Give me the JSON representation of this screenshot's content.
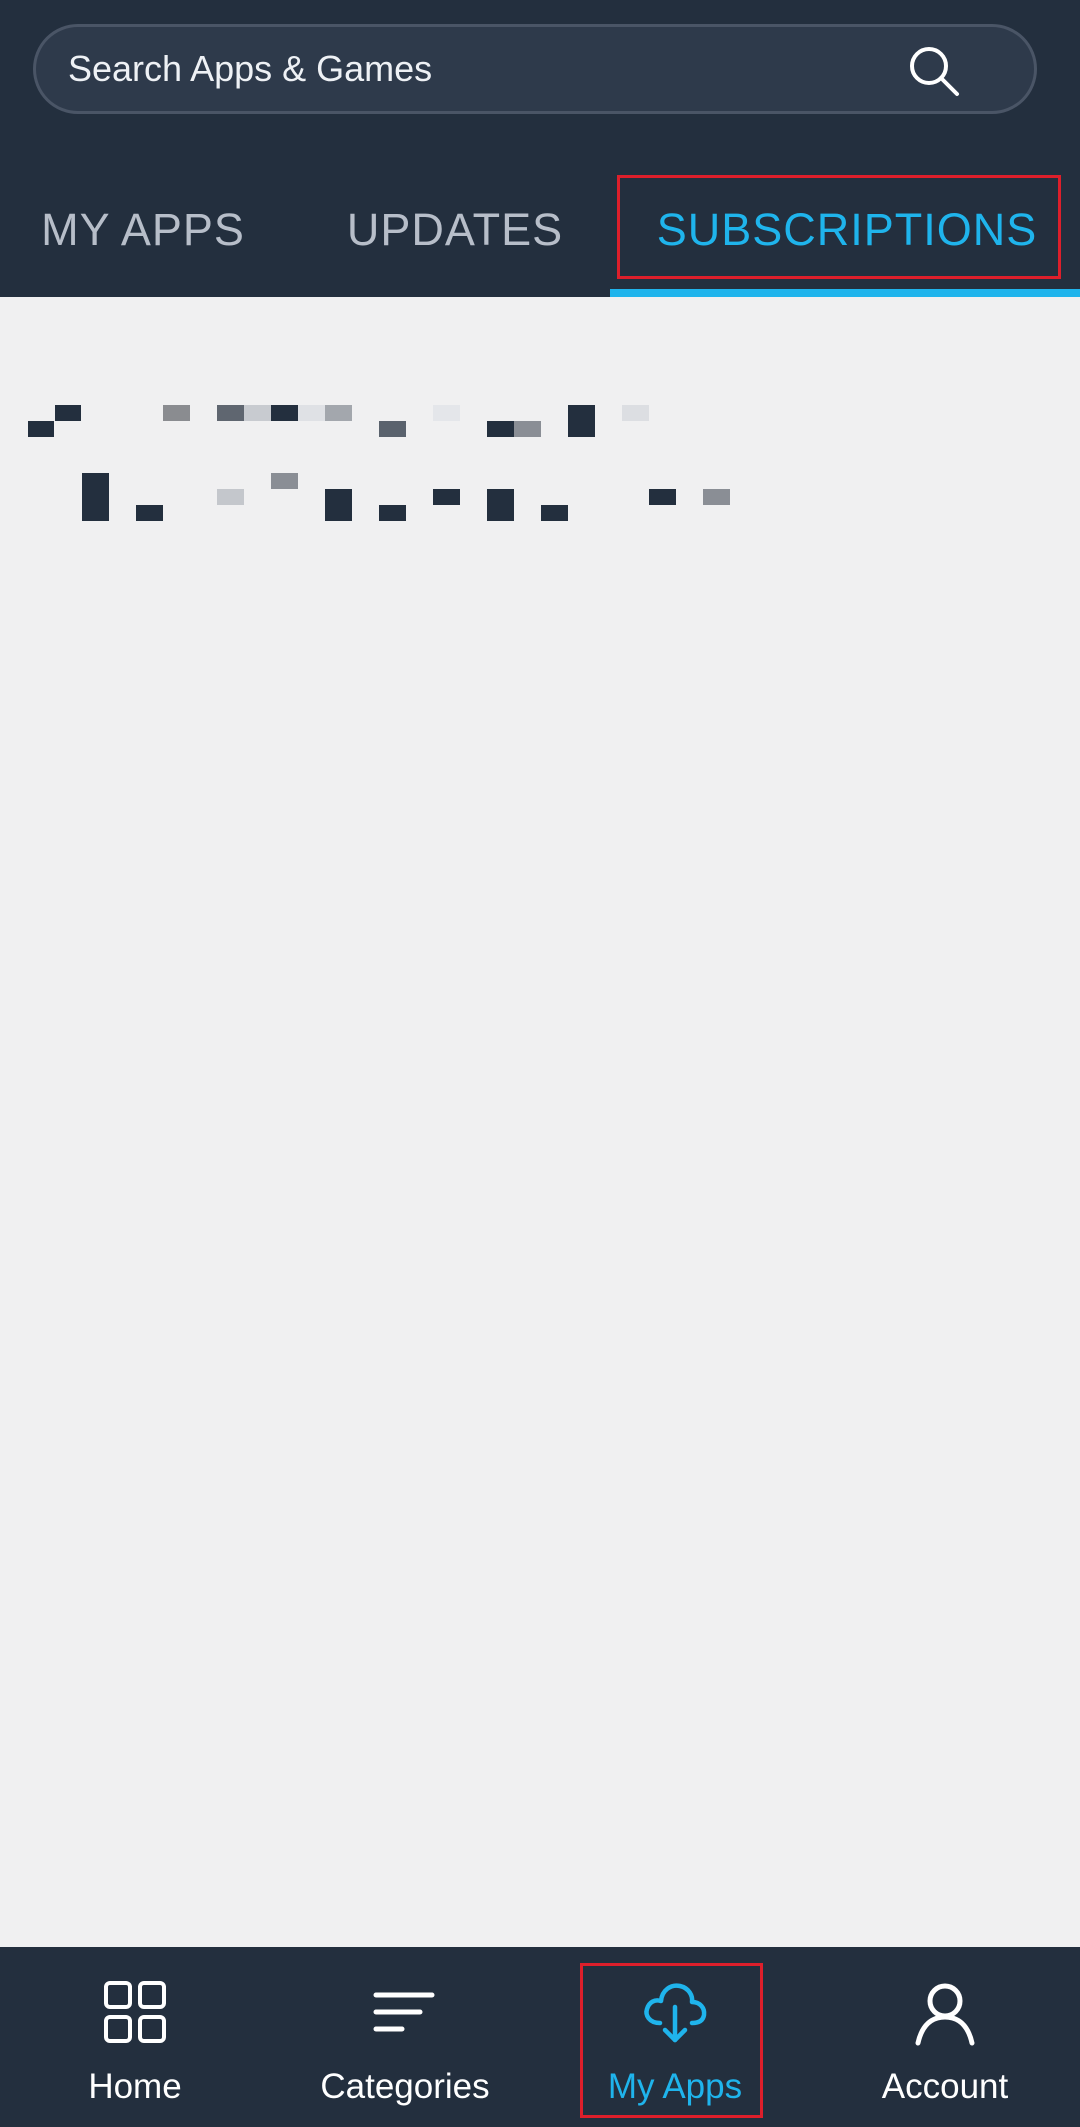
{
  "search": {
    "placeholder": "Search Apps & Games",
    "icon": "search-icon"
  },
  "tabs": [
    {
      "label": "MY APPS",
      "active": false
    },
    {
      "label": "UPDATES",
      "active": false
    },
    {
      "label": "SUBSCRIPTIONS",
      "active": true
    }
  ],
  "colors": {
    "header_bg": "#232f3e",
    "accent": "#1fb4ec",
    "content_bg": "#f0f0f1",
    "highlight": "#dd1f2b"
  },
  "bottom_nav": {
    "items": [
      {
        "label": "Home",
        "icon": "grid-icon",
        "active": false
      },
      {
        "label": "Categories",
        "icon": "lines-icon",
        "active": false
      },
      {
        "label": "My Apps",
        "icon": "cloud-download-icon",
        "active": true
      },
      {
        "label": "Account",
        "icon": "person-icon",
        "active": false
      }
    ]
  }
}
